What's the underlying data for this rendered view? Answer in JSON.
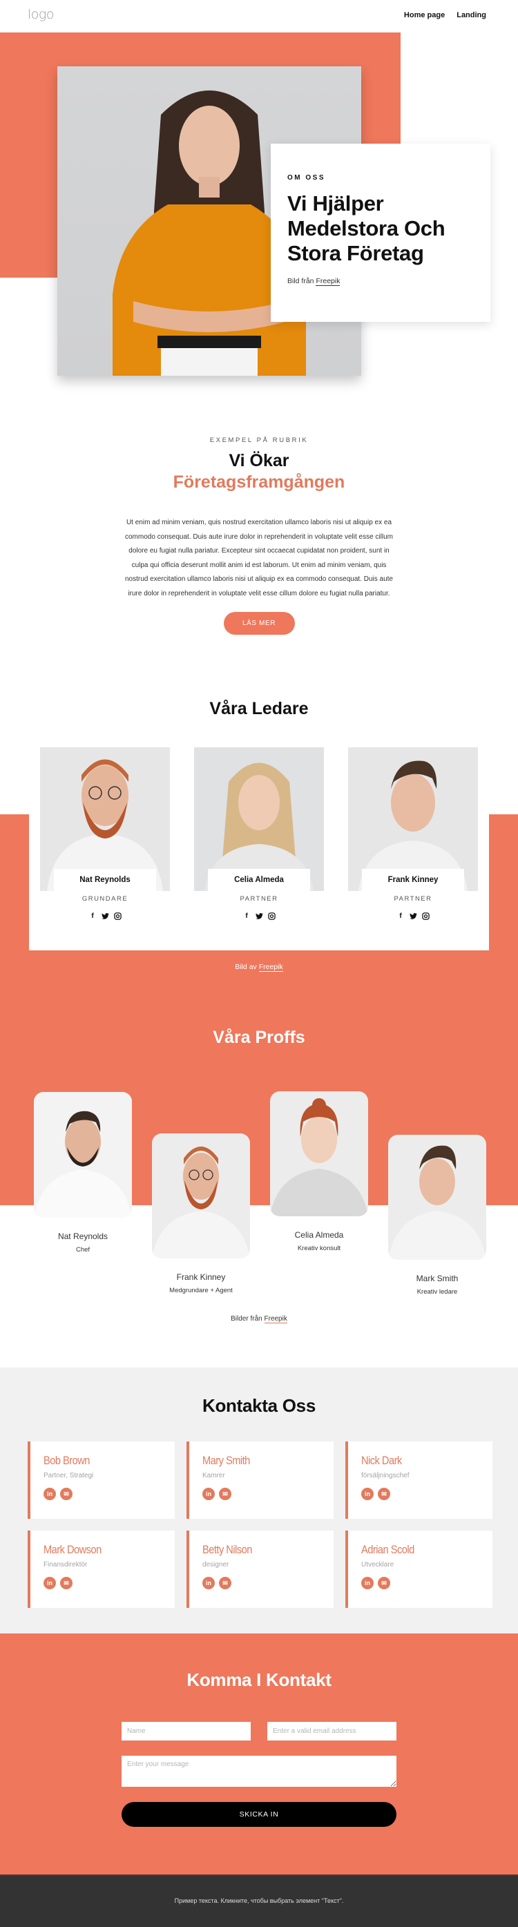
{
  "header": {
    "logo": "logo",
    "nav": [
      "Home page",
      "Landing"
    ]
  },
  "hero": {
    "eyebrow": "OM OSS",
    "title": "Vi Hjälper Medelstora Och Stora Företag",
    "credit_prefix": "Bild från",
    "credit_link": "Freepik"
  },
  "intro": {
    "eyebrow": "EXEMPEL PÅ RUBRIK",
    "title_line1": "Vi Ökar",
    "title_line2": "Företagsframgången",
    "body": "Ut enim ad minim veniam, quis nostrud exercitation ullamco laboris nisi ut aliquip ex ea commodo consequat. Duis aute irure dolor in reprehenderit in voluptate velit esse cillum dolore eu fugiat nulla pariatur. Excepteur sint occaecat cupidatat non proident, sunt in culpa qui officia deserunt mollit anim id est laborum. Ut enim ad minim veniam, quis nostrud exercitation ullamco laboris nisi ut aliquip ex ea commodo consequat. Duis aute irure dolor in reprehenderit in voluptate velit esse cillum dolore eu fugiat nulla pariatur.",
    "button": "LÄS MER"
  },
  "leaders": {
    "title": "Våra Ledare",
    "items": [
      {
        "name": "Nat Reynolds",
        "role": "GRUNDARE"
      },
      {
        "name": "Celia Almeda",
        "role": "PARTNER"
      },
      {
        "name": "Frank Kinney",
        "role": "PARTNER"
      }
    ],
    "social_icons": [
      "facebook-icon",
      "twitter-icon",
      "instagram-icon"
    ],
    "credit_prefix": "Bild av",
    "credit_link": "Freepik"
  },
  "pros": {
    "title": "Våra Proffs",
    "items": [
      {
        "name": "Nat Reynolds",
        "role": "Chef"
      },
      {
        "name": "Frank Kinney",
        "role": "Medgrundare + Agent"
      },
      {
        "name": "Celia Almeda",
        "role": "Kreativ konsult"
      },
      {
        "name": "Mark Smith",
        "role": "Kreativ ledare"
      }
    ],
    "credit_prefix": "Bilder från",
    "credit_link": "Freepik"
  },
  "contact": {
    "title": "Kontakta Oss",
    "items": [
      {
        "name": "Bob Brown",
        "role": "Partner, Strategi"
      },
      {
        "name": "Mary Smith",
        "role": "Kamrer"
      },
      {
        "name": "Nick Dark",
        "role": "försäljningschef"
      },
      {
        "name": "Mark Dowson",
        "role": "Finansdirektör"
      },
      {
        "name": "Betty Nilson",
        "role": "designer"
      },
      {
        "name": "Adrian Scold",
        "role": "Utvecklare"
      }
    ],
    "icons": [
      "linkedin-icon",
      "email-icon"
    ]
  },
  "form": {
    "title": "Komma I Kontakt",
    "name_placeholder": "Name",
    "email_placeholder": "Enter a valid email address",
    "message_placeholder": "Enter your message",
    "submit": "SKICKA IN"
  },
  "footer": {
    "text": "Пример текста. Кликните, чтобы выбрать элемент \"Текст\"."
  },
  "colors": {
    "accent": "#ef775b",
    "accent_text": "#e27a5d",
    "dark": "#111111",
    "footer_bg": "#333333",
    "contact_bg": "#f1f1f1"
  }
}
